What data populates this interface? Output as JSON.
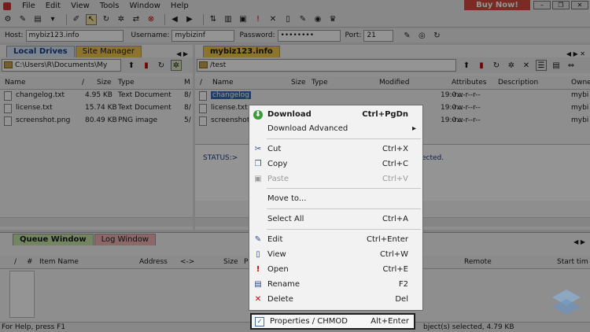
{
  "menu": {
    "items": [
      "File",
      "Edit",
      "View",
      "Tools",
      "Window",
      "Help"
    ],
    "buy_now": "Buy Now!"
  },
  "connection": {
    "host_label": "Host:",
    "host": "mybiz123.info",
    "username_label": "Username:",
    "username": "mybizinf",
    "password_label": "Password:",
    "password": "••••••••",
    "port_label": "Port:",
    "port": "21"
  },
  "local": {
    "tabs": [
      "Local Drives",
      "Site Manager"
    ],
    "path": "C:\\Users\\R\\Documents\\My",
    "columns": [
      "Name",
      "/",
      "Size",
      "Type",
      "M"
    ],
    "files": [
      {
        "name": "changelog.txt",
        "size": "4.95 KB",
        "type": "Text Document",
        "mod": "8/"
      },
      {
        "name": "license.txt",
        "size": "15.74 KB",
        "type": "Text Document",
        "mod": "8/"
      },
      {
        "name": "screenshot.png",
        "size": "80.49 KB",
        "type": "PNG image",
        "mod": "5/"
      }
    ]
  },
  "remote": {
    "tab": "mybiz123.info",
    "path": "/test",
    "columns": [
      "/",
      "Name",
      "Size",
      "Type",
      "Modified",
      "Attributes",
      "Description",
      "Owne"
    ],
    "files": [
      {
        "name": "changelog",
        "modified": "19:0...",
        "attr": "-rw-r--r--",
        "owner": "mybi"
      },
      {
        "name": "license.txt",
        "modified": "19:0...",
        "attr": "-rw-r--r--",
        "owner": "mybi"
      },
      {
        "name": "screenshot",
        "modified": "19:0...",
        "attr": "-rw-r--r--",
        "owner": "mybi"
      }
    ],
    "log_status": "STATUS:>",
    "log_text": "ected."
  },
  "queue": {
    "tabs": [
      "Queue Window",
      "Log Window"
    ],
    "columns": [
      "/",
      "#",
      "Item Name",
      "Address",
      "<->",
      "Size",
      "P",
      "Remote",
      "Start tim"
    ]
  },
  "context_menu": {
    "items": [
      {
        "label": "Download",
        "shortcut": "Ctrl+PgDn",
        "bold": true
      },
      {
        "label": "Download Advanced",
        "shortcut": ""
      },
      {
        "label": "Cut",
        "shortcut": "Ctrl+X"
      },
      {
        "label": "Copy",
        "shortcut": "Ctrl+C"
      },
      {
        "label": "Paste",
        "shortcut": "Ctrl+V"
      },
      {
        "label": "Move to...",
        "shortcut": ""
      },
      {
        "label": "Select All",
        "shortcut": "Ctrl+A"
      },
      {
        "label": "Edit",
        "shortcut": "Ctrl+Enter"
      },
      {
        "label": "View",
        "shortcut": "Ctrl+W"
      },
      {
        "label": "Open",
        "shortcut": "Ctrl+E"
      },
      {
        "label": "Rename",
        "shortcut": "F2"
      },
      {
        "label": "Delete",
        "shortcut": "Del"
      }
    ],
    "highlighted": {
      "label": "Properties / CHMOD",
      "shortcut": "Alt+Enter"
    }
  },
  "status": {
    "left": "For Help, press F1",
    "right": "bject(s) selected, 4.79 KB"
  }
}
